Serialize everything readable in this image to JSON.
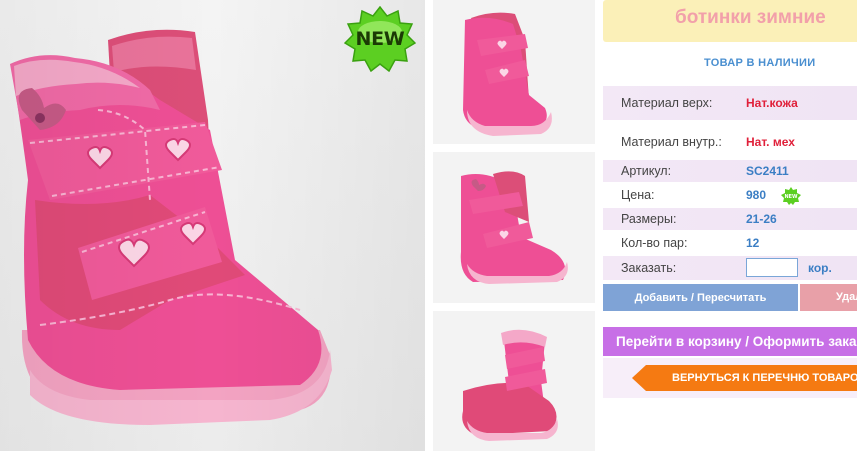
{
  "product": {
    "title": "ботинки зимние",
    "badge": "NEW",
    "mini_badge": "NEW",
    "availability": "ТОВАР В НАЛИЧИИ"
  },
  "attributes": [
    {
      "label": "Материал верх:",
      "value": "Нат.кожа"
    },
    {
      "label": "Материал внутр.:",
      "value": "Нат. мех"
    },
    {
      "label": "Артикул:",
      "value": "SC2411"
    },
    {
      "label": "Цена:",
      "value": "980"
    },
    {
      "label": "Размеры:",
      "value": "21-26"
    },
    {
      "label": "Кол-во пар:",
      "value": "12"
    }
  ],
  "order": {
    "label": "Заказать:",
    "quantity_value": "",
    "unit": "кор."
  },
  "buttons": {
    "add": "Добавить / Пересчитать",
    "delete": "Удалить",
    "cart": "Перейти в корзину / Оформить заказ",
    "back": "ВЕРНУТЬСЯ К ПЕРЕЧНЮ ТОВАРОВ"
  },
  "colors": {
    "title_bg": "#fbf0b8",
    "title_text": "#f2a0aa",
    "accent_blue": "#3b7ec4",
    "accent_red": "#e0203a",
    "cart_button": "#c76fe6",
    "back_button": "#f57a12",
    "boot_pink": "#ee4f95"
  },
  "icons": [
    "new-badge-icon",
    "boot-photo",
    "back-arrow-icon"
  ]
}
